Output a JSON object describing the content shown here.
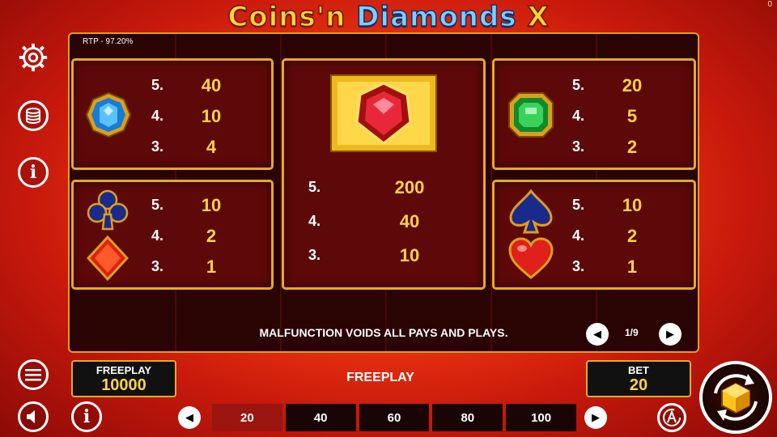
{
  "title": {
    "part1": "Coins'n ",
    "part2": "Diamonds ",
    "part3": "X"
  },
  "corner_counter": "0",
  "rtp": "RTP - 97.20%",
  "paytable": {
    "blue_diamond": {
      "icon": "blue-gem-icon",
      "rows": [
        {
          "count": "5.",
          "value": "40"
        },
        {
          "count": "4.",
          "value": "10"
        },
        {
          "count": "3.",
          "value": "4"
        }
      ]
    },
    "red_gem_center": {
      "icon": "red-gem-gold-frame-icon",
      "rows": [
        {
          "count": "5.",
          "value": "200"
        },
        {
          "count": "4.",
          "value": "40"
        },
        {
          "count": "3.",
          "value": "10"
        }
      ]
    },
    "green_emerald": {
      "icon": "green-emerald-icon",
      "rows": [
        {
          "count": "5.",
          "value": "20"
        },
        {
          "count": "4.",
          "value": "5"
        },
        {
          "count": "3.",
          "value": "2"
        }
      ]
    },
    "club_diamond": {
      "icons": [
        "club-icon",
        "diamond-suit-icon"
      ],
      "rows": [
        {
          "count": "5.",
          "value": "10"
        },
        {
          "count": "4.",
          "value": "2"
        },
        {
          "count": "3.",
          "value": "1"
        }
      ]
    },
    "spade_heart": {
      "icons": [
        "spade-icon",
        "heart-icon"
      ],
      "rows": [
        {
          "count": "5.",
          "value": "10"
        },
        {
          "count": "4.",
          "value": "2"
        },
        {
          "count": "3.",
          "value": "1"
        }
      ]
    }
  },
  "disclaimer": "MALFUNCTION VOIDS ALL PAYS AND PLAYS.",
  "page_indicator": "1/9",
  "balance": {
    "label": "FREEPLAY",
    "value": "10000"
  },
  "mode_label": "FREEPLAY",
  "bet": {
    "label": "BET",
    "value": "20"
  },
  "bet_options": [
    "20",
    "40",
    "60",
    "80",
    "100"
  ],
  "selected_bet": "20",
  "colors": {
    "accent_gold": "#e6a82a",
    "value_yellow": "#ffd24a",
    "panel_red": "#5e0909",
    "selected_bet": "#9a1510"
  },
  "side_icons": [
    "gear-icon",
    "coin-stack-icon",
    "info-icon",
    "menu-icon",
    "speaker-icon",
    "info-icon"
  ]
}
